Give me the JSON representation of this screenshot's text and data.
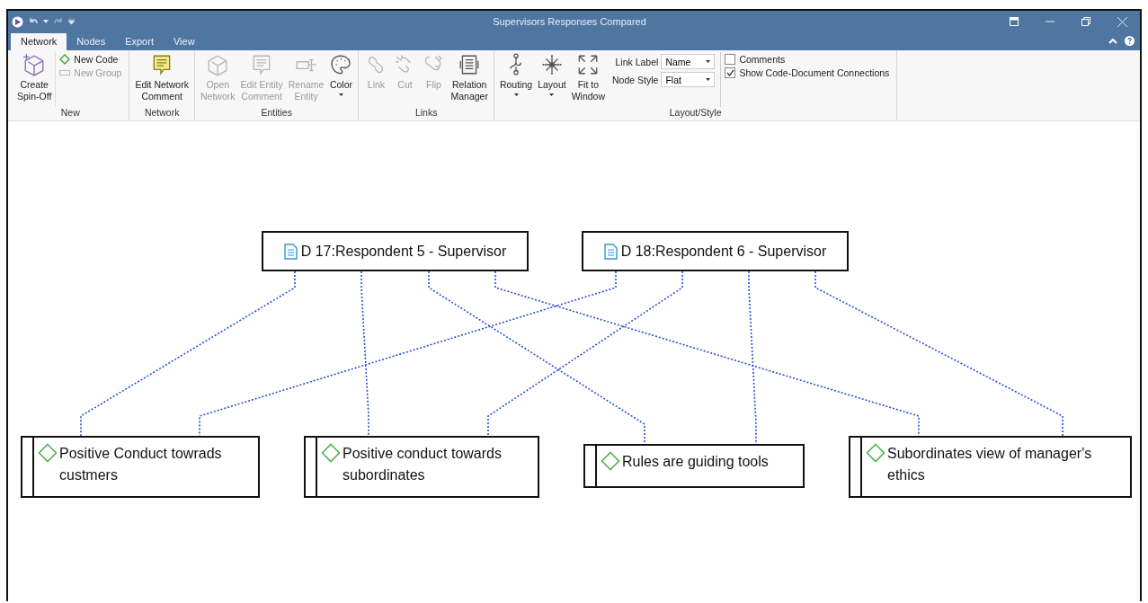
{
  "window": {
    "title": "Supervisors Responses Compared"
  },
  "tabs": [
    {
      "label": "Network",
      "selected": true
    },
    {
      "label": "Nodes",
      "selected": false
    },
    {
      "label": "Export",
      "selected": false
    },
    {
      "label": "View",
      "selected": false
    }
  ],
  "ribbon": [
    {
      "label": "New",
      "items": [
        {
          "kind": "large",
          "label": "Create\nSpin-Off",
          "disabled": false,
          "dropdown": false
        },
        {
          "kind": "stack",
          "entries": [
            {
              "label": "New Code",
              "disabled": false
            },
            {
              "label": "New Group",
              "disabled": true
            }
          ]
        }
      ]
    },
    {
      "label": "Network",
      "items": [
        {
          "kind": "large",
          "label": "Edit Network\nComment",
          "disabled": false,
          "dropdown": false
        }
      ]
    },
    {
      "label": "Entities",
      "items": [
        {
          "kind": "large",
          "label": "Open\nNetwork",
          "disabled": true,
          "dropdown": false
        },
        {
          "kind": "large",
          "label": "Edit Entity\nComment",
          "disabled": true,
          "dropdown": false
        },
        {
          "kind": "large",
          "label": "Rename\nEntity",
          "disabled": true,
          "dropdown": false
        },
        {
          "kind": "large",
          "label": "Color",
          "disabled": false,
          "dropdown": true
        }
      ]
    },
    {
      "label": "Links",
      "items": [
        {
          "kind": "large",
          "label": "Link",
          "disabled": true,
          "dropdown": false
        },
        {
          "kind": "large",
          "label": "Cut",
          "disabled": true,
          "dropdown": false
        },
        {
          "kind": "large",
          "label": "Flip",
          "disabled": true,
          "dropdown": false
        },
        {
          "kind": "large",
          "label": "Relation\nManager",
          "disabled": false,
          "dropdown": false
        }
      ]
    },
    {
      "label": "Layout/Style",
      "items": [
        {
          "kind": "large",
          "label": "Routing",
          "disabled": false,
          "dropdown": true
        },
        {
          "kind": "large",
          "label": "Layout",
          "disabled": false,
          "dropdown": true
        },
        {
          "kind": "large",
          "label": "Fit to\nWindow",
          "disabled": false,
          "dropdown": false
        },
        {
          "kind": "fields",
          "entries": [
            {
              "label": "Link Label",
              "value": "Name"
            },
            {
              "label": "Node Style",
              "value": "Flat"
            }
          ]
        },
        {
          "kind": "checks",
          "entries": [
            {
              "label": "Comments",
              "checked": false
            },
            {
              "label": "Show Code-Document Connections",
              "checked": true
            }
          ]
        }
      ]
    }
  ],
  "documents": [
    {
      "label": "D 17:Respondent 5 - Supervisor"
    },
    {
      "label": "D 18:Respondent 6 - Supervisor"
    }
  ],
  "codes": [
    {
      "label": "Positive Conduct towrads custmers"
    },
    {
      "label": "Positive conduct towards subordinates"
    },
    {
      "label": "Rules are guiding tools"
    },
    {
      "label": "Subordinates view of manager's ethics"
    }
  ]
}
